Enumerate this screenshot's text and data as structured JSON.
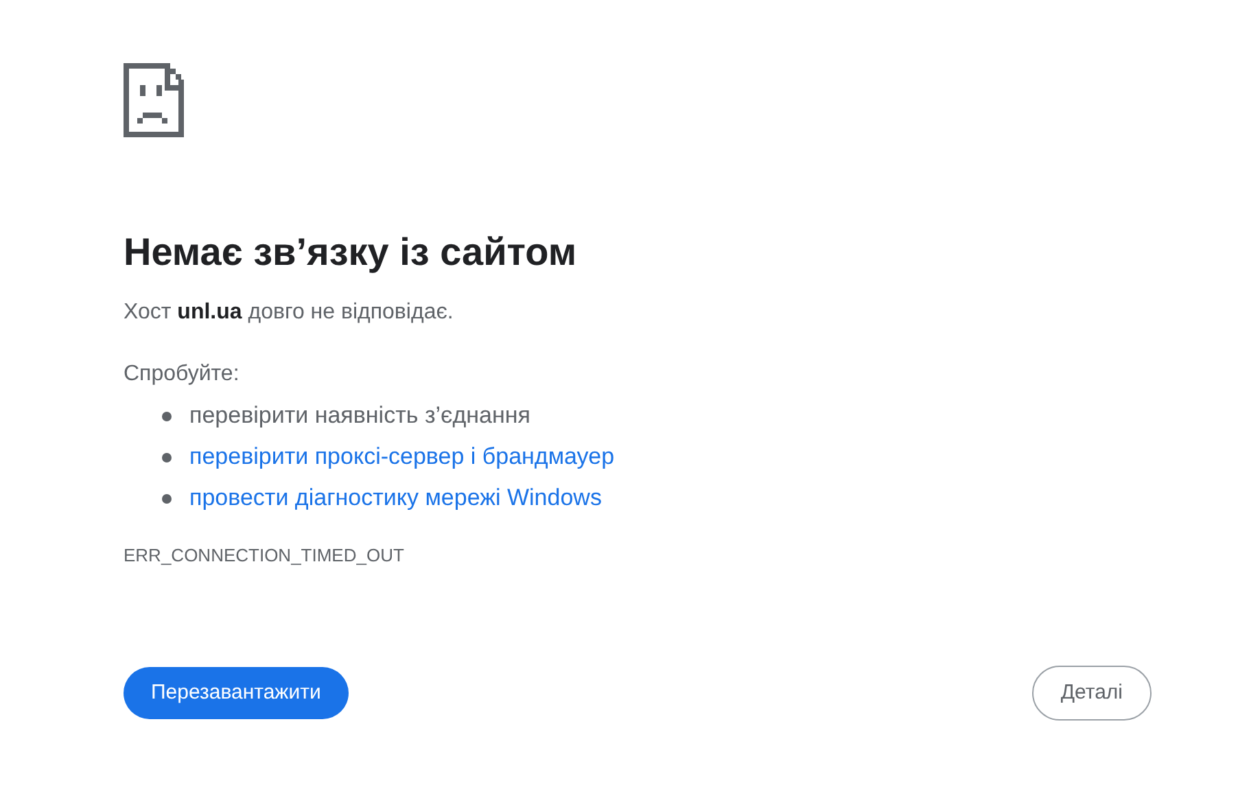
{
  "heading": "Немає зв’язку із сайтом",
  "message": "Хост **unl.ua** довго не відповідає.",
  "suggestions_title": "Спробуйте:",
  "suggestions": [
    {
      "kind": "text",
      "label": "перевірити наявність з’єднання"
    },
    {
      "kind": "link",
      "label": "перевірити проксі-сервер і брандмауер"
    },
    {
      "kind": "link",
      "label": "провести діагностику мережі Windows"
    }
  ],
  "error_code": "ERR_CONNECTION_TIMED_OUT",
  "buttons": {
    "primary": "Перезавантажити",
    "secondary": "Деталі"
  }
}
